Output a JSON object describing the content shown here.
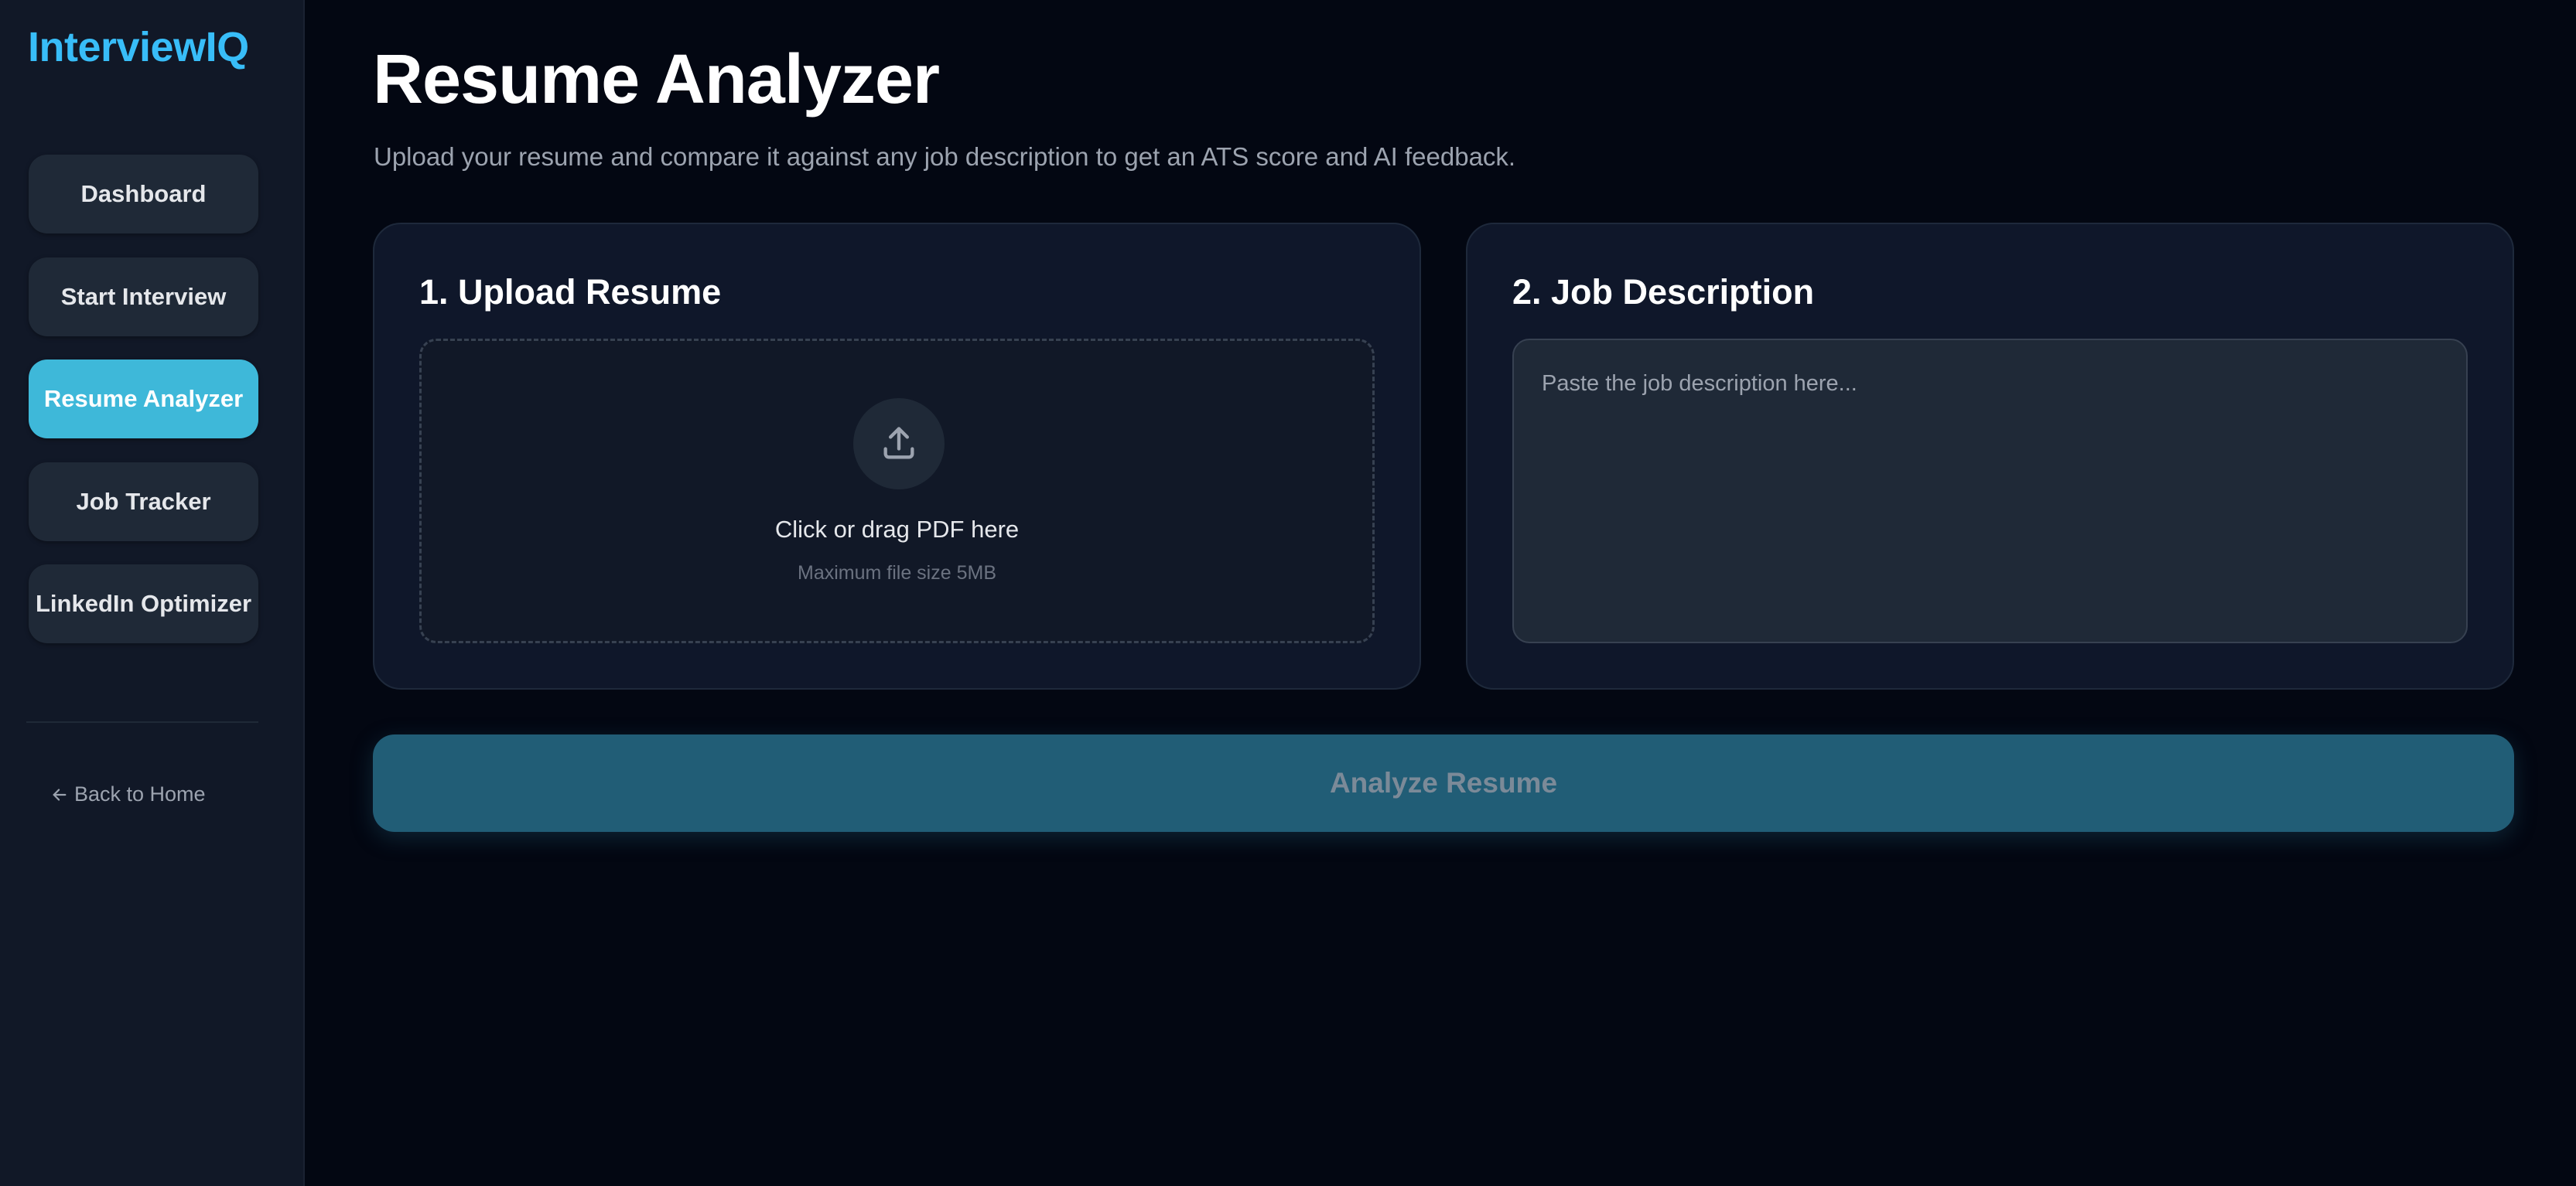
{
  "sidebar": {
    "brand": "InterviewIQ",
    "items": [
      {
        "label": "Dashboard"
      },
      {
        "label": "Start Interview"
      },
      {
        "label": "Resume Analyzer"
      },
      {
        "label": "Job Tracker"
      },
      {
        "label": "LinkedIn Optimizer"
      }
    ],
    "active_item": "Resume Analyzer",
    "back_link": "Back to Home"
  },
  "main": {
    "title": "Resume Analyzer",
    "subtitle": "Upload your resume and compare it against any job description to get an ATS score and AI feedback.",
    "upload_card": {
      "title": "1. Upload Resume",
      "drop_text": "Click or drag PDF here",
      "hint": "Maximum file size 5MB",
      "icon": "upload-icon"
    },
    "job_card": {
      "title": "2. Job Description",
      "value": "",
      "placeholder": "Paste the job description here..."
    },
    "analyze_button": {
      "label": "Analyze Resume",
      "disabled": true
    }
  },
  "colors": {
    "background": "#030712",
    "sidebar": "#111827",
    "accent": "#38bdf8",
    "active_nav": "#3eb8d9",
    "button_disabled": "#215d76"
  }
}
